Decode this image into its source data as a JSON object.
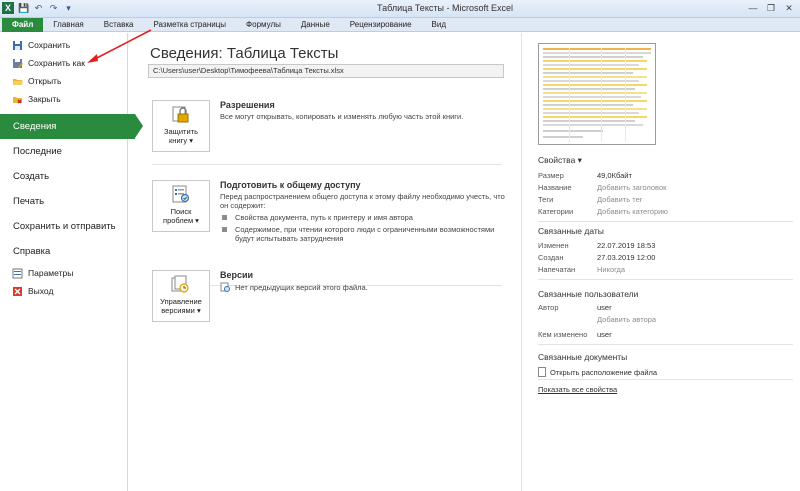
{
  "titlebar": {
    "title": "Таблица Тексты  -  Microsoft Excel",
    "app_icon": "X",
    "save_icon": "💾",
    "undo_icon": "↶",
    "redo_icon": "↷",
    "customize_icon": "▾",
    "minimize": "—",
    "maximize": "❐",
    "close": "✕"
  },
  "ribbon": {
    "tabs": [
      "Файл",
      "Главная",
      "Вставка",
      "Разметка страницы",
      "Формулы",
      "Данные",
      "Рецензирование",
      "Вид"
    ]
  },
  "leftmenu": {
    "save": "Сохранить",
    "save_as": "Сохранить как",
    "open": "Открыть",
    "close": "Закрыть",
    "info": "Сведения",
    "recent": "Последние",
    "new": "Создать",
    "print": "Печать",
    "save_send": "Сохранить и отправить",
    "help": "Справка",
    "options": "Параметры",
    "exit": "Выход"
  },
  "main": {
    "title": "Сведения: Таблица Тексты",
    "path": "C:\\Users\\user\\Desktop\\Тимофеева\\Таблица Тексты.xlsx",
    "permissions": {
      "button_line1": "Защитить",
      "button_line2": "книгу ▾",
      "title": "Разрешения",
      "desc": "Все могут открывать, копировать и изменять любую часть этой книги."
    },
    "prepare": {
      "button_line1": "Поиск",
      "button_line2": "проблем ▾",
      "title": "Подготовить к общему доступу",
      "desc": "Перед распространением общего доступа к этому файлу необходимо учесть, что он содержит:",
      "bullet1": "Свойства документа, путь к принтеру и имя автора",
      "bullet2": "Содержимое, при чтении которого люди с ограниченными возможностями будут испытывать затруднения"
    },
    "versions": {
      "button_line1": "Управление",
      "button_line2": "версиями ▾",
      "title": "Версии",
      "desc": "Нет предыдущих версий этого файла."
    }
  },
  "right": {
    "properties_header": "Свойства ▾",
    "size_label": "Размер",
    "size_value": "49,0Кбайт",
    "title_label": "Название",
    "title_value": "Добавить заголовок",
    "tags_label": "Теги",
    "tags_value": "Добавить тег",
    "categories_label": "Категории",
    "categories_value": "Добавить категорию",
    "dates_header": "Связанные даты",
    "modified_label": "Изменен",
    "modified_value": "22.07.2019 18:53",
    "created_label": "Создан",
    "created_value": "27.03.2019 12:00",
    "printed_label": "Напечатан",
    "printed_value": "Никогда",
    "people_header": "Связанные пользователи",
    "author_label": "Автор",
    "author_value": "user",
    "add_author": "Добавить автора",
    "modified_by_label": "Кем изменено",
    "modified_by_value": "user",
    "docs_header": "Связанные документы",
    "open_location": "Открыть расположение файла",
    "show_all": "Показать все свойства"
  },
  "colors": {
    "accent_green": "#2a8a3e",
    "annotation_red": "#e02020"
  }
}
